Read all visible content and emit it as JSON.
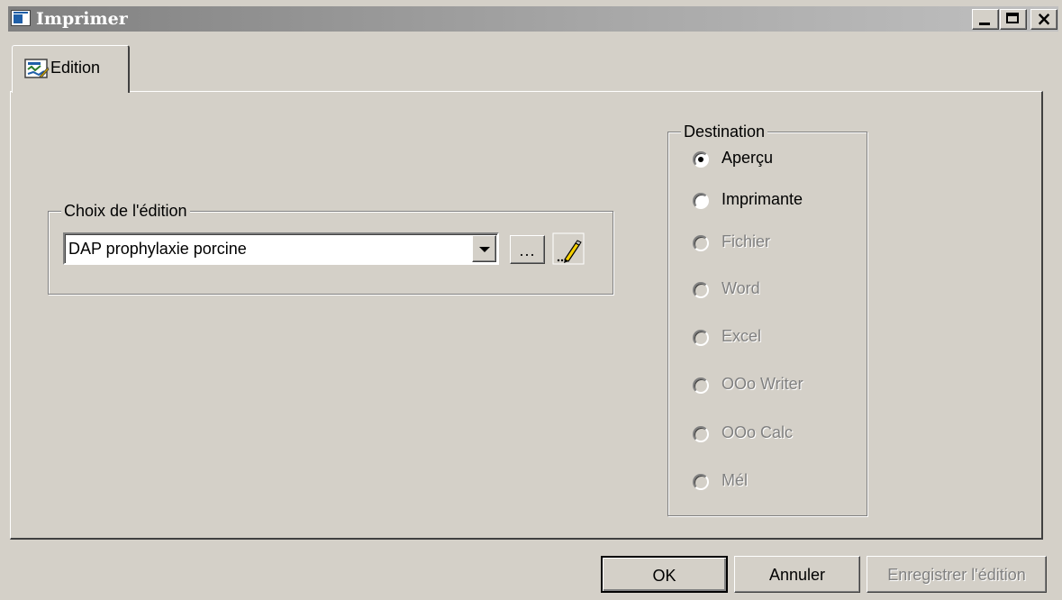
{
  "window": {
    "title": "Imprimer",
    "close_glyph": "×"
  },
  "tab": {
    "label": "Edition",
    "icon": "edition-icon"
  },
  "choix": {
    "legend": "Choix de l'édition",
    "selected": "DAP prophylaxie porcine",
    "browse_label": "..."
  },
  "destination": {
    "legend": "Destination",
    "options": [
      {
        "label": "Aperçu",
        "checked": true,
        "enabled": true
      },
      {
        "label": "Imprimante",
        "checked": false,
        "enabled": true
      },
      {
        "label": "Fichier",
        "checked": false,
        "enabled": false
      },
      {
        "label": "Word",
        "checked": false,
        "enabled": false
      },
      {
        "label": "Excel",
        "checked": false,
        "enabled": false
      },
      {
        "label": "OOo Writer",
        "checked": false,
        "enabled": false
      },
      {
        "label": "OOo Calc",
        "checked": false,
        "enabled": false
      },
      {
        "label": "Mél",
        "checked": false,
        "enabled": false
      }
    ]
  },
  "buttons": {
    "ok": "OK",
    "cancel": "Annuler",
    "save": "Enregistrer l'édition"
  }
}
